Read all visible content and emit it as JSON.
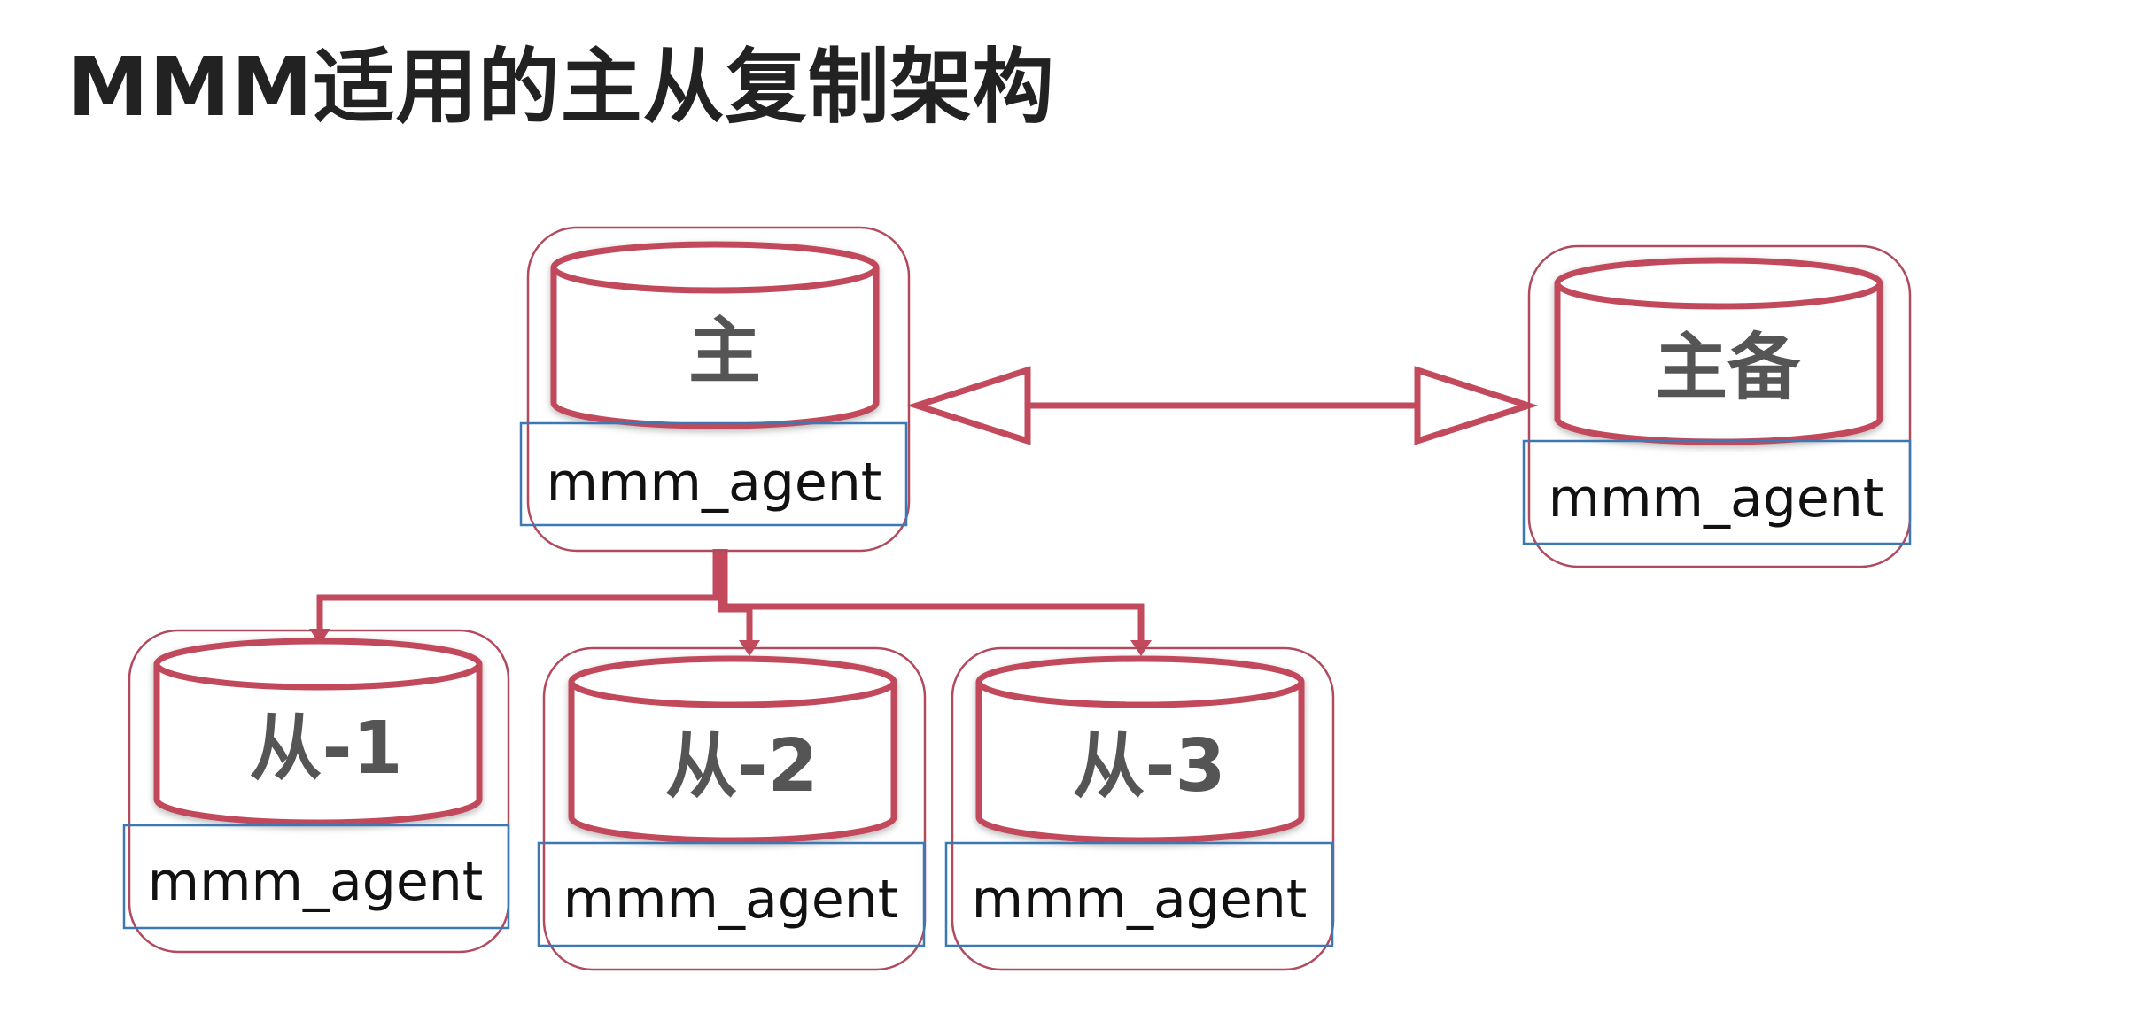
{
  "title": "MMM适用的主从复制架构",
  "colors": {
    "node_border": "#b24a5e",
    "agent_border": "#3c78b4",
    "connector": "#c24a5c",
    "label_text": "#555555",
    "title_text": "#222222"
  },
  "nodes": [
    {
      "id": "master",
      "label": "主",
      "agent": "mmm_agent"
    },
    {
      "id": "standby",
      "label": "主备",
      "agent": "mmm_agent"
    },
    {
      "id": "slave-1",
      "label": "从-1",
      "agent": "mmm_agent"
    },
    {
      "id": "slave-2",
      "label": "从-2",
      "agent": "mmm_agent"
    },
    {
      "id": "slave-3",
      "label": "从-3",
      "agent": "mmm_agent"
    }
  ],
  "edges": [
    {
      "from": "master",
      "to": "standby",
      "type": "bidirectional-replication"
    },
    {
      "from": "master",
      "to": "slave-1",
      "type": "replication"
    },
    {
      "from": "master",
      "to": "slave-2",
      "type": "replication"
    },
    {
      "from": "master",
      "to": "slave-3",
      "type": "replication"
    }
  ]
}
